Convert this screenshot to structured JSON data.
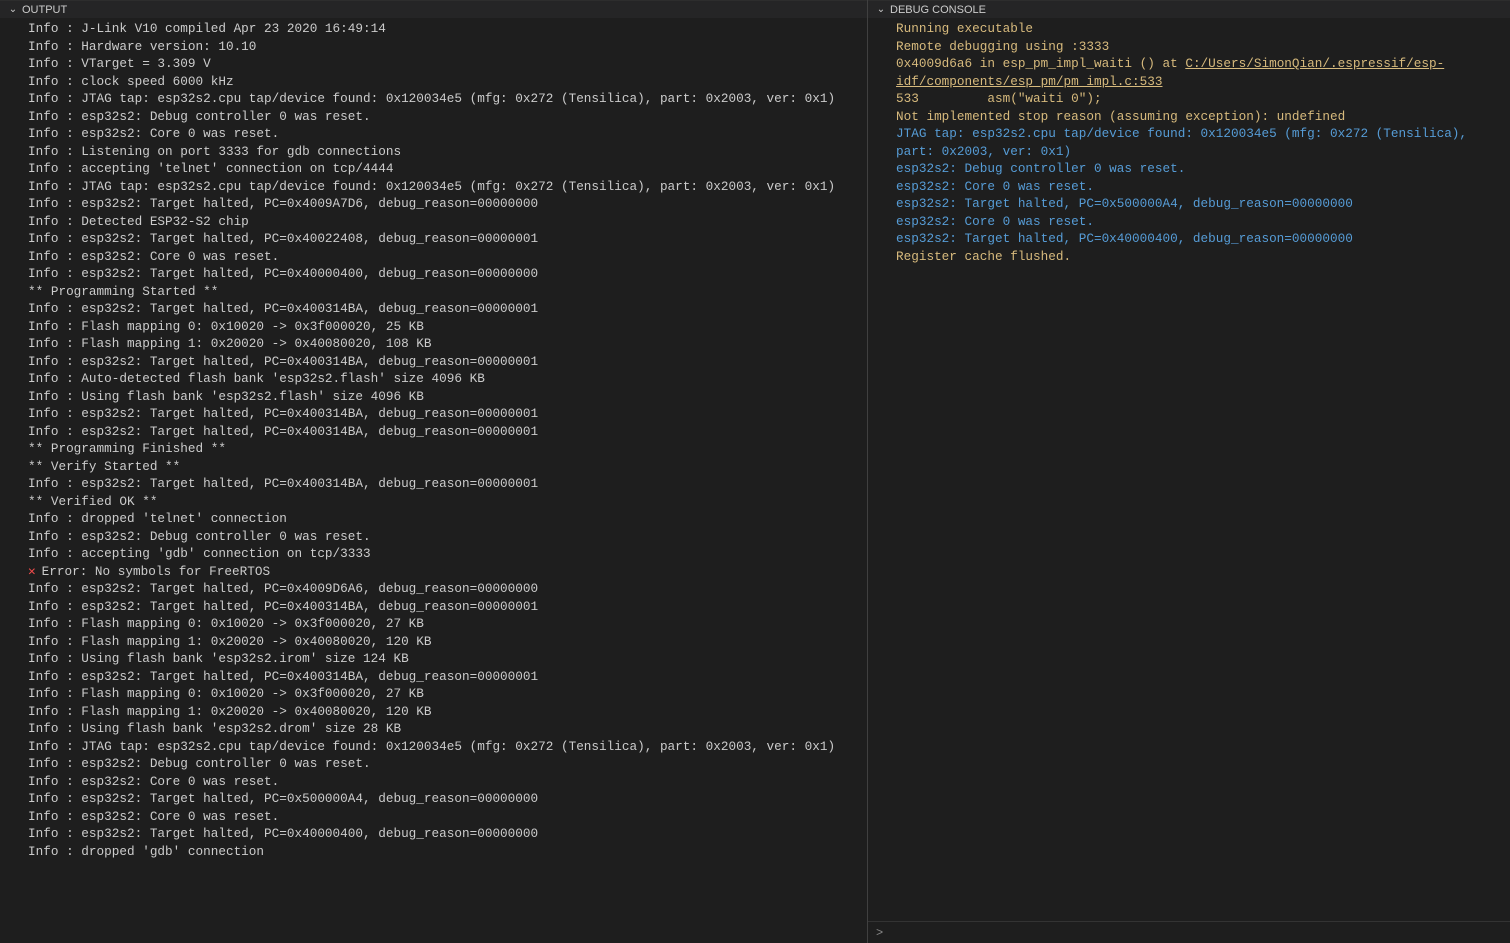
{
  "left": {
    "title": "OUTPUT",
    "lines": [
      {
        "text": "Info : J-Link V10 compiled Apr 23 2020 16:49:14"
      },
      {
        "text": "Info : Hardware version: 10.10"
      },
      {
        "text": "Info : VTarget = 3.309 V"
      },
      {
        "text": "Info : clock speed 6000 kHz"
      },
      {
        "text": "Info : JTAG tap: esp32s2.cpu tap/device found: 0x120034e5 (mfg: 0x272 (Tensilica), part: 0x2003, ver: 0x1)"
      },
      {
        "text": "Info : esp32s2: Debug controller 0 was reset."
      },
      {
        "text": "Info : esp32s2: Core 0 was reset."
      },
      {
        "text": "Info : Listening on port 3333 for gdb connections"
      },
      {
        "text": "Info : accepting 'telnet' connection on tcp/4444"
      },
      {
        "text": "Info : JTAG tap: esp32s2.cpu tap/device found: 0x120034e5 (mfg: 0x272 (Tensilica), part: 0x2003, ver: 0x1)"
      },
      {
        "text": "Info : esp32s2: Target halted, PC=0x4009A7D6, debug_reason=00000000"
      },
      {
        "text": "Info : Detected ESP32-S2 chip"
      },
      {
        "text": "Info : esp32s2: Target halted, PC=0x40022408, debug_reason=00000001"
      },
      {
        "text": "Info : esp32s2: Core 0 was reset."
      },
      {
        "text": "Info : esp32s2: Target halted, PC=0x40000400, debug_reason=00000000"
      },
      {
        "text": "** Programming Started **"
      },
      {
        "text": "Info : esp32s2: Target halted, PC=0x400314BA, debug_reason=00000001"
      },
      {
        "text": "Info : Flash mapping 0: 0x10020 -> 0x3f000020, 25 KB"
      },
      {
        "text": "Info : Flash mapping 1: 0x20020 -> 0x40080020, 108 KB"
      },
      {
        "text": "Info : esp32s2: Target halted, PC=0x400314BA, debug_reason=00000001"
      },
      {
        "text": "Info : Auto-detected flash bank 'esp32s2.flash' size 4096 KB"
      },
      {
        "text": "Info : Using flash bank 'esp32s2.flash' size 4096 KB"
      },
      {
        "text": "Info : esp32s2: Target halted, PC=0x400314BA, debug_reason=00000001"
      },
      {
        "text": "Info : esp32s2: Target halted, PC=0x400314BA, debug_reason=00000001"
      },
      {
        "text": "** Programming Finished **"
      },
      {
        "text": "** Verify Started **"
      },
      {
        "text": "Info : esp32s2: Target halted, PC=0x400314BA, debug_reason=00000001"
      },
      {
        "text": "** Verified OK **"
      },
      {
        "text": "Info : dropped 'telnet' connection"
      },
      {
        "text": "Info : esp32s2: Debug controller 0 was reset."
      },
      {
        "text": "Info : accepting 'gdb' connection on tcp/3333"
      },
      {
        "type": "error",
        "text": "Error: No symbols for FreeRTOS"
      },
      {
        "text": "Info : esp32s2: Target halted, PC=0x4009D6A6, debug_reason=00000000"
      },
      {
        "text": "Info : esp32s2: Target halted, PC=0x400314BA, debug_reason=00000001"
      },
      {
        "text": "Info : Flash mapping 0: 0x10020 -> 0x3f000020, 27 KB"
      },
      {
        "text": "Info : Flash mapping 1: 0x20020 -> 0x40080020, 120 KB"
      },
      {
        "text": "Info : Using flash bank 'esp32s2.irom' size 124 KB"
      },
      {
        "text": "Info : esp32s2: Target halted, PC=0x400314BA, debug_reason=00000001"
      },
      {
        "text": "Info : Flash mapping 0: 0x10020 -> 0x3f000020, 27 KB"
      },
      {
        "text": "Info : Flash mapping 1: 0x20020 -> 0x40080020, 120 KB"
      },
      {
        "text": "Info : Using flash bank 'esp32s2.drom' size 28 KB"
      },
      {
        "text": "Info : JTAG tap: esp32s2.cpu tap/device found: 0x120034e5 (mfg: 0x272 (Tensilica), part: 0x2003, ver: 0x1)"
      },
      {
        "text": "Info : esp32s2: Debug controller 0 was reset."
      },
      {
        "text": "Info : esp32s2: Core 0 was reset."
      },
      {
        "text": "Info : esp32s2: Target halted, PC=0x500000A4, debug_reason=00000000"
      },
      {
        "text": "Info : esp32s2: Core 0 was reset."
      },
      {
        "text": "Info : esp32s2: Target halted, PC=0x40000400, debug_reason=00000000"
      },
      {
        "text": "Info : dropped 'gdb' connection"
      }
    ]
  },
  "right": {
    "title": "DEBUG CONSOLE",
    "lines": [
      {
        "cls": "c-gold",
        "text": "Running executable"
      },
      {
        "cls": "c-gold",
        "text": "Remote debugging using :3333"
      },
      {
        "type": "link-line",
        "prefix": "0x4009d6a6 in esp_pm_impl_waiti () at ",
        "link": "C:/Users/SimonQian/.espressif/esp-idf/components/esp_pm/pm_impl.c:533"
      },
      {
        "cls": "c-gold",
        "text": "533         asm(\"waiti 0\");"
      },
      {
        "cls": "c-gold",
        "text": "Not implemented stop reason (assuming exception): undefined"
      },
      {
        "cls": "c-blue",
        "text": "JTAG tap: esp32s2.cpu tap/device found: 0x120034e5 (mfg: 0x272 (Tensilica), part: 0x2003, ver: 0x1)"
      },
      {
        "cls": "c-blue",
        "text": "esp32s2: Debug controller 0 was reset."
      },
      {
        "cls": "c-blue",
        "text": "esp32s2: Core 0 was reset."
      },
      {
        "cls": "c-blue",
        "text": "esp32s2: Target halted, PC=0x500000A4, debug_reason=00000000"
      },
      {
        "cls": "c-blue",
        "text": "esp32s2: Core 0 was reset."
      },
      {
        "cls": "c-blue",
        "text": "esp32s2: Target halted, PC=0x40000400, debug_reason=00000000"
      },
      {
        "cls": "c-gold",
        "text": "Register cache flushed."
      }
    ],
    "prompt": ">"
  }
}
